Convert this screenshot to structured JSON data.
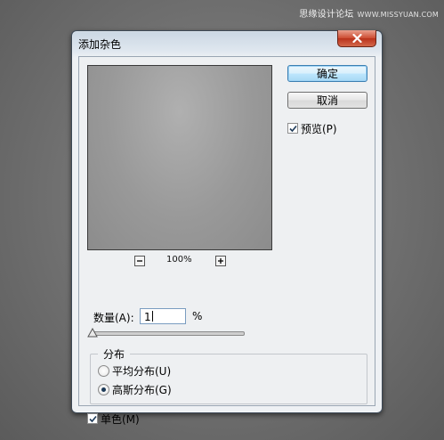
{
  "watermark": {
    "text": "思缘设计论坛",
    "site": "WWW.MISSYUAN.COM"
  },
  "dialog": {
    "title": "添加杂色",
    "buttons": {
      "ok": "确定",
      "cancel": "取消"
    },
    "preview_checkbox": {
      "label": "预览(P)",
      "checked": true
    },
    "zoom": {
      "value": "100%",
      "minus": "−",
      "plus": "+"
    },
    "amount": {
      "label": "数量(A):",
      "value": "1",
      "unit": "%"
    },
    "distribution": {
      "title": "分布",
      "options": [
        {
          "label": "平均分布(U)",
          "selected": false
        },
        {
          "label": "高斯分布(G)",
          "selected": true
        }
      ]
    },
    "monochromatic": {
      "label": "单色(M)",
      "checked": true
    }
  },
  "icons": {
    "close": "close-icon",
    "check": "checkmark-icon",
    "slider_thumb": "triangle-thumb-icon"
  }
}
